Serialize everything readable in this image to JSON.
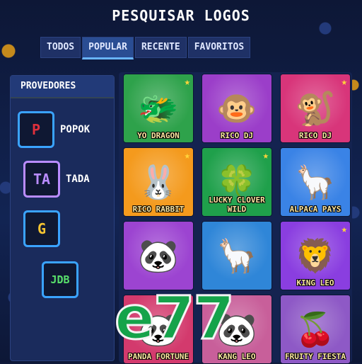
{
  "header": {
    "title": "PESQUISAR LOGOS"
  },
  "tabs": [
    {
      "label": "TODOS",
      "active": false
    },
    {
      "label": "POPULAR",
      "active": true
    },
    {
      "label": "RECENTE",
      "active": false
    },
    {
      "label": "FAVORITOS",
      "active": false
    }
  ],
  "sidebar": {
    "heading": "PROVEDORES",
    "providers": [
      {
        "name": "POPOK",
        "logo_text": "P",
        "color": "#e0303c"
      },
      {
        "name": "TADA",
        "logo_text": "TA",
        "color": "#b98cff"
      },
      {
        "name": "",
        "logo_text": "G",
        "color": "#f6c531"
      },
      {
        "name": "",
        "logo_text": "JDB",
        "color": "#58e06b"
      }
    ]
  },
  "games": [
    {
      "label": "YO DRAGON",
      "icon": "dragon-icon",
      "glyph": "🐲",
      "bg": "#2ea24b",
      "star": true
    },
    {
      "label": "RICO DJ",
      "icon": "monkey-dj-icon",
      "glyph": "🐵",
      "bg": "#9b3ec9",
      "star": false
    },
    {
      "label": "RICO DJ",
      "icon": "monkey-icon",
      "glyph": "🐒",
      "bg": "#d8357a",
      "star": true
    },
    {
      "label": "RICO RABBIT",
      "icon": "rabbit-icon",
      "glyph": "🐰",
      "bg": "#f49a1d",
      "star": true
    },
    {
      "label": "LUCKY CLOVER WILD",
      "icon": "clover-icon",
      "glyph": "🍀",
      "bg": "#1fa04b",
      "star": true
    },
    {
      "label": "ALPACA PAYS",
      "icon": "alpaca-icon",
      "glyph": "🦙",
      "bg": "#3a83e6",
      "star": false
    },
    {
      "label": "",
      "icon": "panda-bear-icon",
      "glyph": "🐼",
      "bg": "#9c44d1",
      "star": false
    },
    {
      "label": "",
      "icon": "alpaca-icon",
      "glyph": "🦙",
      "bg": "#2f86d8",
      "star": false
    },
    {
      "label": "KING LEO",
      "icon": "lion-icon",
      "glyph": "🦁",
      "bg": "#8a3ee0",
      "star": true
    },
    {
      "label": "PANDA FORTUNE",
      "icon": "panda-icon",
      "glyph": "🐼",
      "bg": "#d33a6d",
      "star": false
    },
    {
      "label": "KANG LEO",
      "icon": "panda-icon",
      "glyph": "🐼",
      "bg": "#c85f9a",
      "star": false
    },
    {
      "label": "FRUITY FIESTA",
      "icon": "fruit-icon",
      "glyph": "🍒",
      "bg": "#8e59c6",
      "star": false
    }
  ],
  "watermark": "e77"
}
